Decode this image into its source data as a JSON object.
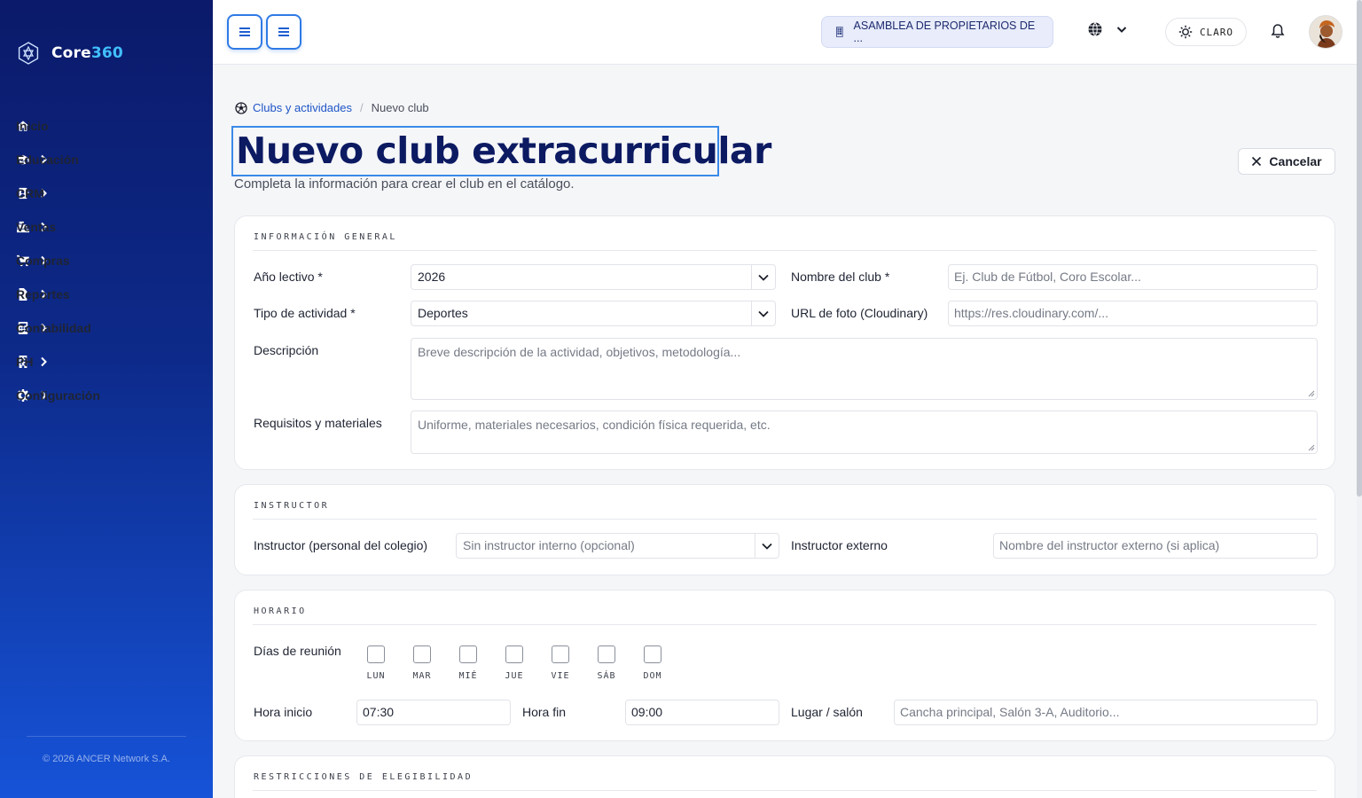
{
  "brand": {
    "name_a": "Core",
    "name_b": "360"
  },
  "sidebar": {
    "items": [
      {
        "label": "Inicio",
        "icon": "home-icon"
      },
      {
        "label": "Educación",
        "icon": "graduation-cap-icon"
      },
      {
        "label": "CRM",
        "icon": "contact-card-icon"
      },
      {
        "label": "Ventas",
        "icon": "cash-register-icon"
      },
      {
        "label": "Compras",
        "icon": "shopping-cart-icon"
      },
      {
        "label": "Reportes",
        "icon": "report-file-icon"
      },
      {
        "label": "Contabilidad",
        "icon": "calculator-icon"
      },
      {
        "label": "PH",
        "icon": "building-icon"
      },
      {
        "label": "Configuración",
        "icon": "gear-icon"
      }
    ],
    "copyright": "© 2026 ANCER Network S.A."
  },
  "topbar": {
    "org": "ASAMBLEA DE PROPIETARIOS DE ...",
    "theme_label": "CLARO"
  },
  "breadcrumb": {
    "parent": "Clubs y actividades",
    "separator": "/",
    "current": "Nuevo club"
  },
  "page": {
    "title": "Nuevo club extracurricular",
    "subtitle": "Completa la información para crear el club en el catálogo.",
    "cancel": "Cancelar"
  },
  "general": {
    "title": "INFORMACIÓN GENERAL",
    "year_label": "Año lectivo *",
    "year_value": "2026",
    "name_label": "Nombre del club *",
    "name_placeholder": "Ej. Club de Fútbol, Coro Escolar...",
    "type_label": "Tipo de actividad *",
    "type_value": "Deportes",
    "photo_label": "URL de foto (Cloudinary)",
    "photo_placeholder": "https://res.cloudinary.com/...",
    "desc_label": "Descripción",
    "desc_placeholder": "Breve descripción de la actividad, objetivos, metodología...",
    "req_label": "Requisitos y materiales",
    "req_placeholder": "Uniforme, materiales necesarios, condición física requerida, etc."
  },
  "instructor": {
    "title": "INSTRUCTOR",
    "internal_label": "Instructor (personal del colegio)",
    "internal_placeholder": "Sin instructor interno (opcional)",
    "external_label": "Instructor externo",
    "external_placeholder": "Nombre del instructor externo (si aplica)"
  },
  "schedule": {
    "title": "HORARIO",
    "days_label": "Días de reunión",
    "days": [
      "LUN",
      "MAR",
      "MIÉ",
      "JUE",
      "VIE",
      "SÁB",
      "DOM"
    ],
    "start_label": "Hora inicio",
    "start_value": "07:30",
    "end_label": "Hora fin",
    "end_value": "09:00",
    "place_label": "Lugar / salón",
    "place_placeholder": "Cancha principal, Salón 3-A, Auditorio..."
  },
  "eligibility": {
    "title": "RESTRICCIONES DE ELEGIBILIDAD"
  },
  "colors": {
    "sidebar_top": "#0b1a6a",
    "sidebar_bottom": "#1653d8",
    "accent": "#2f7ae5",
    "title": "#0c1a62",
    "brand_accent": "#41c0ff"
  }
}
